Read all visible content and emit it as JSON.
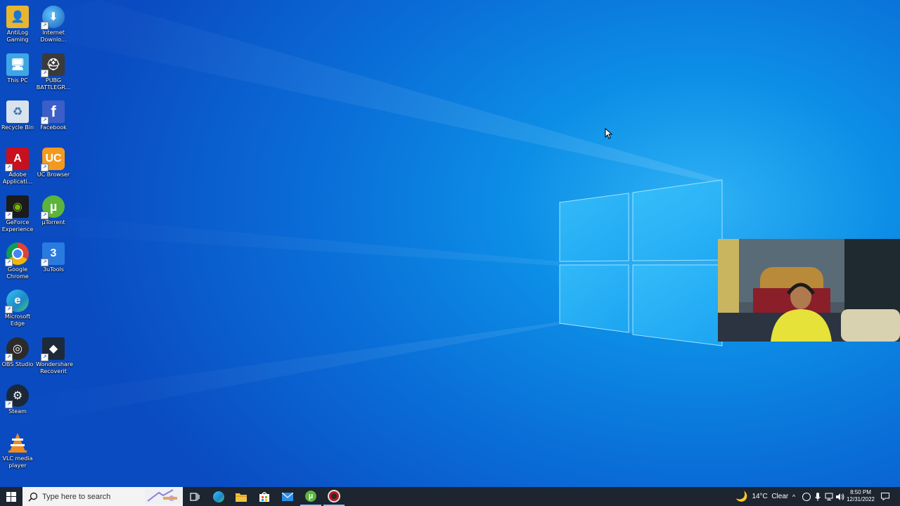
{
  "desktop": {
    "icons": [
      {
        "label": "AntiLog Gaming",
        "icon": "folder-user-icon",
        "color": "#e8b530"
      },
      {
        "label": "Internet Downlo...",
        "icon": "internet-download-manager-icon",
        "color": "#2e9b3a"
      },
      {
        "label": "This PC",
        "icon": "this-pc-icon",
        "color": "#3fa6e6"
      },
      {
        "label": "PUBG BATTLEGR...",
        "icon": "pubg-icon",
        "color": "#3a3a3a"
      },
      {
        "label": "Recycle Bin",
        "icon": "recycle-bin-icon",
        "color": "#d8e3ee"
      },
      {
        "label": "Facebook",
        "icon": "facebook-icon",
        "color": "#3b5ec9"
      },
      {
        "label": "Adobe Applicati...",
        "icon": "adobe-icon",
        "color": "#c8101e"
      },
      {
        "label": "UC Browser",
        "icon": "uc-browser-icon",
        "color": "#f39a1e"
      },
      {
        "label": "GeForce Experience",
        "icon": "geforce-icon",
        "color": "#1b1b1b"
      },
      {
        "label": "µTorrent",
        "icon": "utorrent-icon",
        "color": "#5bb43b"
      },
      {
        "label": "Google Chrome",
        "icon": "chrome-icon",
        "color": "#db4437"
      },
      {
        "label": "3uTools",
        "icon": "3utools-icon",
        "color": "#2a7be0"
      },
      {
        "label": "Microsoft Edge",
        "icon": "edge-icon",
        "color": "#1e88c7"
      },
      {
        "label": "OBS Studio",
        "icon": "obs-icon",
        "color": "#2b2b2b"
      },
      {
        "label": "Wondershare Recoverit",
        "icon": "recoverit-icon",
        "color": "#1d2a3a"
      },
      {
        "label": "Steam",
        "icon": "steam-icon",
        "color": "#1b2838"
      },
      {
        "label": "VLC media player",
        "icon": "vlc-icon",
        "color": "#f08a1c"
      }
    ]
  },
  "taskbar": {
    "search_placeholder": "Type here to search",
    "weather": "14°C  Clear",
    "time": "8:50 PM",
    "date": "12/31/2022"
  }
}
